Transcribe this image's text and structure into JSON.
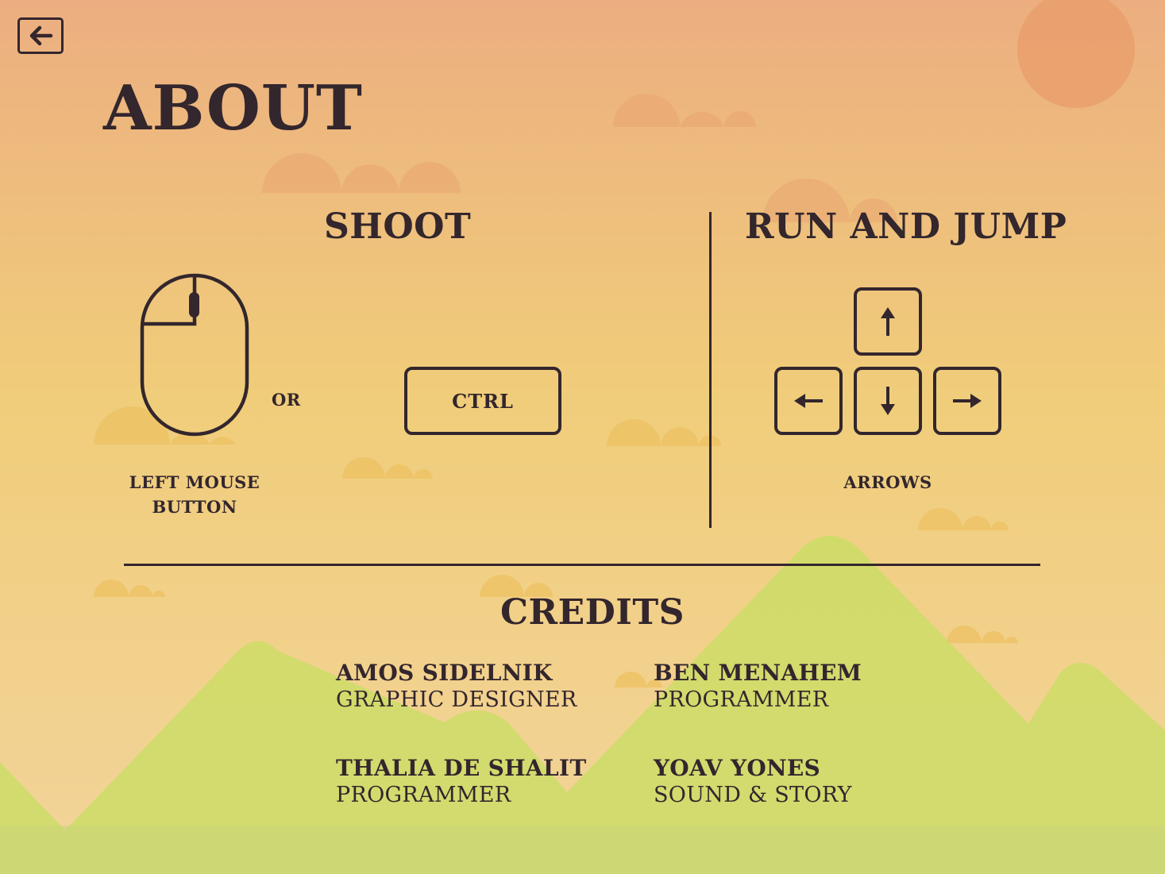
{
  "page": {
    "title": "ABOUT",
    "back_icon": "arrow-left-icon"
  },
  "colors": {
    "sky_top": "#ecae80",
    "sky_mid": "#f0cd7a",
    "sky_bottom": "#f3d49a",
    "cloud": "#eec264",
    "sun": "#e99f6c",
    "hill": "#c9dd64",
    "ink": "#33262d"
  },
  "shoot": {
    "title": "SHOOT",
    "mouse_icon": "mouse-icon",
    "mouse_label_line1": "LEFT MOUSE",
    "mouse_label_line2": "BUTTON",
    "or_label": "OR",
    "key_label": "CTRL"
  },
  "run_jump": {
    "title": "RUN AND JUMP",
    "keys": [
      "arrow-up-icon",
      "arrow-left-icon",
      "arrow-down-icon",
      "arrow-right-icon"
    ],
    "label": "ARROWS"
  },
  "credits": {
    "title": "CREDITS",
    "people": [
      {
        "name": "AMOS SIDELNIK",
        "role": "GRAPHIC DESIGNER"
      },
      {
        "name": "BEN MENAHEM",
        "role": "PROGRAMMER"
      },
      {
        "name": "THALIA DE SHALIT",
        "role": "PROGRAMMER"
      },
      {
        "name": "YOAV YONES",
        "role": "SOUND & STORY"
      }
    ]
  }
}
